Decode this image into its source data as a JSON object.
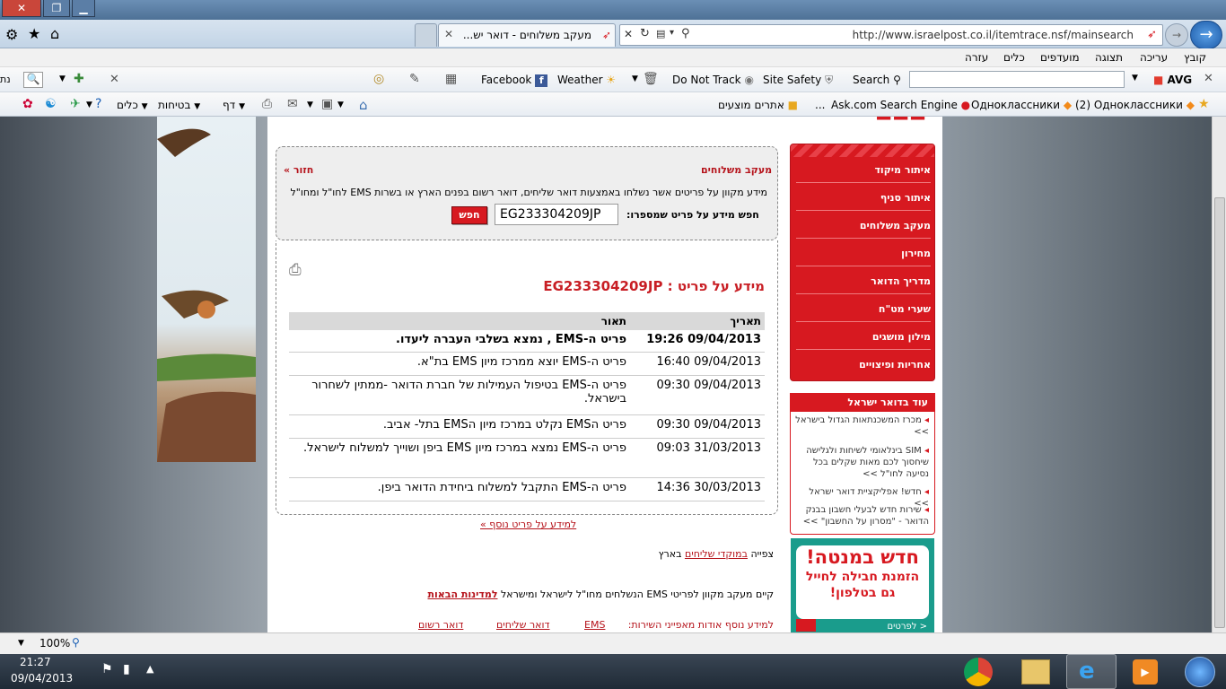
{
  "window": {
    "url": "http://www.israelpost.co.il/itemtrace.nsf/mainsearch",
    "tab_title": "מעקב משלוחים - דואר יש..."
  },
  "menubar": [
    "קובץ",
    "עריכה",
    "תצוגה",
    "מועדפים",
    "כלים",
    "עזרה"
  ],
  "toolbar1": {
    "avg": "AVG",
    "search_label": "Search",
    "site_safety": "Site Safety",
    "do_not_track": "Do Not Track",
    "weather": "Weather",
    "facebook": "Facebook"
  },
  "toolbar2": {
    "odnoklassniki_count": "(2) Одноклассники",
    "odnoklassniki": "Одноклассники",
    "ask_search": "Ask.com Search Engine",
    "more": "...",
    "suggested_sites": "אתרים מוצעים",
    "page": "דף",
    "safety": "בטיחות",
    "tools": "כלים"
  },
  "nav": {
    "items": [
      "איתור מיקוד",
      "איתור סניף",
      "מעקב משלוחים",
      "מחירון",
      "מדריך הדואר",
      "שערי מט\"ח",
      "מילון מושגים",
      "אחריות ופיצויים"
    ]
  },
  "more": {
    "header": "עוד בדואר ישראל",
    "items": [
      "מכרז המשכנתאות הגדול בישראל >>",
      "SIM בינלאומי לשיחות ולגלישה שיחסוך לכם מאות שקלים בכל נסיעה לחו\"ל >>",
      "חדש! אפליקציית דואר ישראל >>",
      "שירות חדש לבעלי חשבון בבנק הדואר - \"מסרון על החשבון\" >>"
    ]
  },
  "ad": {
    "line1": "חדש במנטה!",
    "line2": "הזמנת חבילה לחייל",
    "line3": "גם בטלפון!",
    "link": "לפרטים >"
  },
  "tracking": {
    "title": "מעקב משלוחים",
    "back": "חזור »",
    "description": "מידע מקוון על פריטים אשר נשלחו באמצעות דואר שליחים, דואר רשום בפנים הארץ או בשרות EMS לחו\"ל ומחו\"ל",
    "search_label": "חפש מידע על פריט שמספרו:",
    "search_value": "EG233304209JP",
    "search_button": "חפש"
  },
  "result": {
    "heading": "מידע על פריט : EG233304209JP",
    "col_date": "תאריך",
    "col_desc": "תאור",
    "rows": [
      {
        "date": "09/04/2013 19:26",
        "desc": "פריט ה-EMS , נמצא בשלבי העברה ליעדו.",
        "bold": true
      },
      {
        "date": "09/04/2013 16:40",
        "desc": "פריט ה-EMS יוצא ממרכז מיון EMS בת\"א."
      },
      {
        "date": "09/04/2013 09:30",
        "desc": "פריט ה-EMS בטיפול העמילות של חברת הדואר -ממתין לשחרור בישראל."
      },
      {
        "date": "09/04/2013 09:30",
        "desc": "פריט הEMS נקלט במרכז מיון הEMS בתל- אביב."
      },
      {
        "date": "31/03/2013 09:03",
        "desc": "פריט ה-EMS נמצא במרכז מיון EMS ביפן ושוייך למשלוח לישראל."
      },
      {
        "date": "30/03/2013 14:36",
        "desc": "פריט ה-EMS התקבל למשלוח ביחידת הדואר ביפן."
      }
    ],
    "more_link": "למידע על פריט נוסף »"
  },
  "footer": {
    "line1_prefix": "צפייה",
    "line1_link": "במוקדי שליחים",
    "line1_suffix": "בארץ",
    "line2_text": "קיים מעקב מקוון לפריטי EMS הנשלחים מחו\"ל לישראל ומישראל",
    "line2_link": "למדינות הבאות",
    "line3_text": "למידע נוסף אודות מאפייני השירות:",
    "line3_links": [
      "EMS",
      "דואר שליחים",
      "דואר רשום"
    ]
  },
  "status": {
    "zoom": "100%"
  },
  "taskbar": {
    "time": "21:27",
    "date": "09/04/2013"
  },
  "colors": {
    "brand_red": "#d71920",
    "link_red": "#b5121a"
  }
}
